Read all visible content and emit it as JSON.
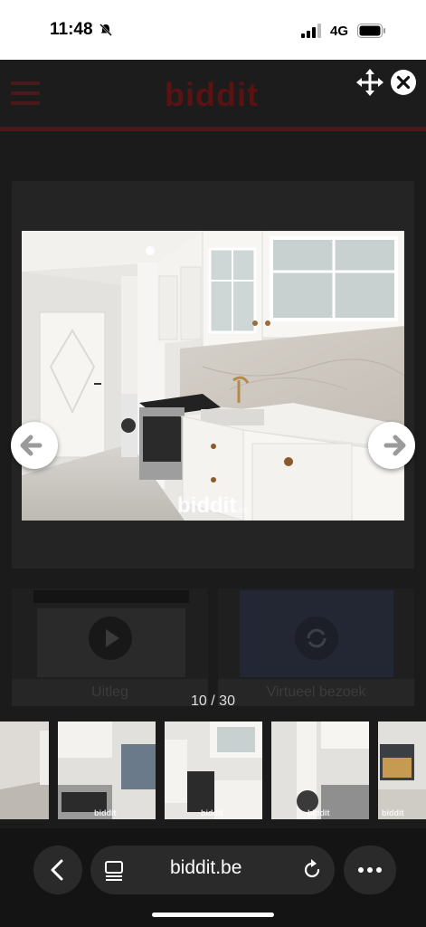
{
  "status_bar": {
    "time": "11:48",
    "network": "4G"
  },
  "site": {
    "logo": "biddit"
  },
  "viewer": {
    "watermark": "biddit",
    "watermark_suffix": ".be",
    "counter": "10 / 30",
    "tiles": [
      {
        "label": "Uitleg"
      },
      {
        "label": "Virtueel bezoek"
      }
    ],
    "thumbnail_watermark": "biddit"
  },
  "browser": {
    "url": "biddit.be"
  },
  "colors": {
    "brand_red": "#c0181f",
    "overlay": "#1b1b1b"
  }
}
